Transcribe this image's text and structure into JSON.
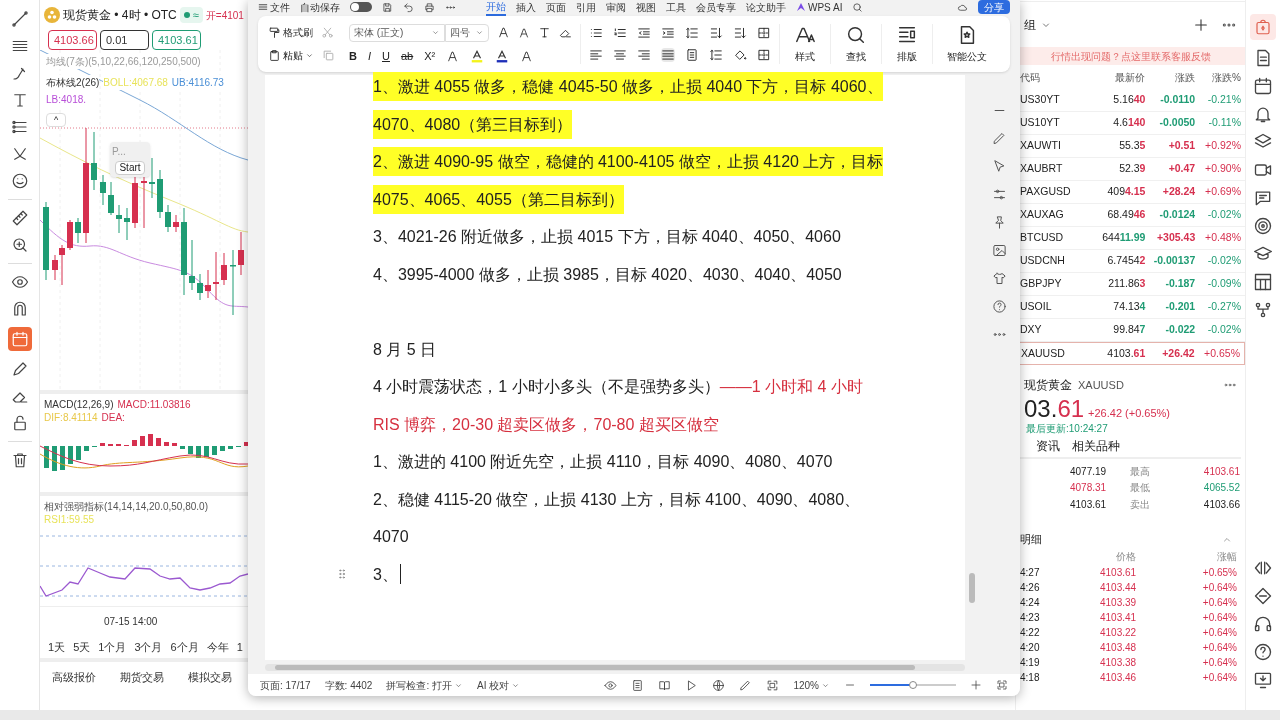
{
  "chart_app": {
    "title": "现货黄金 • 4时 • OTC",
    "status_badge": "≈",
    "open_label": "开=4101",
    "price_boxes": [
      {
        "text": "4103.66",
        "color": "#d6304f"
      },
      {
        "text": "0.01",
        "color": "#333333"
      },
      {
        "text": "4103.61",
        "color": "#1f9c74"
      }
    ],
    "ma_label": "均线(7条)(5,10,22,66,120,250,500)",
    "boll": [
      {
        "text": "布林线2(26)",
        "color": "#333333"
      },
      {
        "text": "BOLL:4067.68",
        "color": "#e8e35a"
      },
      {
        "text": "UB:4116.73",
        "color": "#4a8fd6"
      },
      {
        "text": "LB:4018.",
        "color": "#b84fd8"
      }
    ],
    "collapse": "^",
    "popup_title": "P...",
    "popup_button": "Start",
    "macd": [
      {
        "text": "MACD(12,26,9)",
        "color": "#333333"
      },
      {
        "text": "MACD:11.03816",
        "color": "#d6304f"
      },
      {
        "text": "DIF:8.41114",
        "color": "#e8c84a"
      },
      {
        "text": "DEA:",
        "color": "#d6304f"
      }
    ],
    "rsi": [
      {
        "text": "相对强弱指标(14,14,14,20.0,50,80.0)",
        "color": "#555555"
      },
      {
        "text": "RSI1:59.55",
        "color": "#e8e35a"
      }
    ],
    "time_label": "07-15 14:00",
    "ranges": [
      "1天",
      "5天",
      "1个月",
      "3个月",
      "6个月",
      "今年",
      "1"
    ],
    "bottom_tabs": [
      "高级报价",
      "期货交易",
      "模拟交易"
    ]
  },
  "word": {
    "file_menu": "文件",
    "autosave": "自动保存",
    "autosave_on": false,
    "tabs": [
      {
        "label": "开始",
        "selected": true
      },
      {
        "label": "插入",
        "selected": false
      },
      {
        "label": "页面",
        "selected": false
      },
      {
        "label": "引用",
        "selected": false
      },
      {
        "label": "审阅",
        "selected": false
      },
      {
        "label": "视图",
        "selected": false
      },
      {
        "label": "工具",
        "selected": false
      },
      {
        "label": "会员专享",
        "selected": false
      },
      {
        "label": "论文助手",
        "selected": false
      }
    ],
    "wps_ai": "WPS AI",
    "share": "分享",
    "format_painter": "格式刷",
    "paste": "粘贴",
    "font": "宋体 (正文)",
    "font_size": "四号",
    "format_buttons": [
      "B",
      "I",
      "U",
      "ab",
      "X²"
    ],
    "big_buttons": [
      "样式",
      "查找",
      "排版",
      "智能公文"
    ],
    "paragraphs": [
      {
        "kind": "text",
        "highlighted": true,
        "segments": [
          {
            "text": "1、激进 4055 做多，稳健 4045-50 做多，止损 4040 下方，目标 4060、4070、4080（第三目标到）"
          }
        ]
      },
      {
        "kind": "text",
        "highlighted": true,
        "segments": [
          {
            "text": "2、激进 4090-95 做空，稳健的 4100-4105 做空，止损 4120 上方，目标 4075、4065、4055（第二目标到）"
          }
        ]
      },
      {
        "kind": "text",
        "highlighted": false,
        "segments": [
          {
            "text": "3、4021-26 附近做多，止损 4015 下方，目标 4040、4050、4060"
          }
        ]
      },
      {
        "kind": "text",
        "highlighted": false,
        "segments": [
          {
            "text": "4、3995-4000 做多，止损 3985，目标 4020、4030、4040、4050"
          }
        ]
      },
      {
        "kind": "empty"
      },
      {
        "kind": "text",
        "highlighted": false,
        "segments": [
          {
            "text": "8 月 5 日"
          }
        ]
      },
      {
        "kind": "text",
        "highlighted": false,
        "segments": [
          {
            "text": "4 小时震荡状态，1 小时小多头（不是强势多头）"
          },
          {
            "text": "——1 小时和 4 小时 RIS 博弈，20-30 超卖区做多，70-80 超买区做空",
            "color": "#d6303f"
          }
        ]
      },
      {
        "kind": "text",
        "highlighted": false,
        "segments": [
          {
            "text": "1、激进的 4100 附近先空，止损 4110，目标 4090、4080、4070"
          }
        ]
      },
      {
        "kind": "text",
        "highlighted": false,
        "segments": [
          {
            "text": "2、稳健 4115-20 做空，止损 4130 上方，目标 4100、4090、4080、4070"
          }
        ]
      },
      {
        "kind": "cursor",
        "segments": [
          {
            "text": "3、"
          }
        ]
      }
    ],
    "status": {
      "page": "页面: 17/17",
      "words": "字数: 4402",
      "spell": "拼写检查: 打开",
      "proof": "AI 校对",
      "zoom": "120%",
      "zoom_slider": {
        "level": 0.5
      }
    }
  },
  "market": {
    "group": "组",
    "banner": "行情出现问题？点这里联系客服反馈",
    "columns": [
      "代码",
      "最新价",
      "涨跌",
      "涨跌%"
    ],
    "rows": [
      {
        "symbol": "US30YT",
        "price": {
          "main": "5.16",
          "tail": "40",
          "color": "#d6304f"
        },
        "change": "-0.0110",
        "change_pct": "-0.21%",
        "color": "#1f9c74",
        "selected": false
      },
      {
        "symbol": "US10YT",
        "price": {
          "main": "4.6",
          "tail": "140",
          "color": "#d6304f"
        },
        "change": "-0.0050",
        "change_pct": "-0.11%",
        "color": "#1f9c74",
        "selected": false
      },
      {
        "symbol": "XAUWTI",
        "price": {
          "main": "55.3",
          "tail": "5",
          "color": "#d6304f"
        },
        "change": "+0.51",
        "change_pct": "+0.92%",
        "color": "#d6304f",
        "selected": false
      },
      {
        "symbol": "XAUBRT",
        "price": {
          "main": "52.3",
          "tail": "9",
          "color": "#d6304f"
        },
        "change": "+0.47",
        "change_pct": "+0.90%",
        "color": "#d6304f",
        "selected": false
      },
      {
        "symbol": "PAXGUSD",
        "price": {
          "main": "409",
          "tail": "4.15",
          "color": "#d6304f"
        },
        "change": "+28.24",
        "change_pct": "+0.69%",
        "color": "#d6304f",
        "selected": false
      },
      {
        "symbol": "XAUXAG",
        "price": {
          "main": "68.49",
          "tail": "46",
          "color": "#d6304f"
        },
        "change": "-0.0124",
        "change_pct": "-0.02%",
        "color": "#1f9c74",
        "selected": false
      },
      {
        "symbol": "BTCUSD",
        "price": {
          "main": "644",
          "tail": "11.99",
          "color": "#1f9c74"
        },
        "change": "+305.43",
        "change_pct": "+0.48%",
        "color": "#d6304f",
        "selected": false
      },
      {
        "symbol": "USDCNH",
        "price": {
          "main": "6.7454",
          "tail": "2",
          "color": "#d6304f"
        },
        "change": "-0.00137",
        "change_pct": "-0.02%",
        "color": "#1f9c74",
        "selected": false
      },
      {
        "symbol": "GBPJPY",
        "price": {
          "main": "211.86",
          "tail": "3",
          "color": "#d6304f"
        },
        "change": "-0.187",
        "change_pct": "-0.09%",
        "color": "#1f9c74",
        "selected": false
      },
      {
        "symbol": "USOIL",
        "price": {
          "main": "74.13",
          "tail": "4",
          "color": "#1f9c74"
        },
        "change": "-0.201",
        "change_pct": "-0.27%",
        "color": "#1f9c74",
        "selected": false
      },
      {
        "symbol": "DXY",
        "price": {
          "main": "99.84",
          "tail": "7",
          "color": "#1f9c74"
        },
        "change": "-0.022",
        "change_pct": "-0.02%",
        "color": "#1f9c74",
        "selected": false
      },
      {
        "symbol": "XAUUSD",
        "price": {
          "main": "4103.",
          "tail": "61",
          "color": "#d6304f"
        },
        "change": "+26.42",
        "change_pct": "+0.65%",
        "color": "#d6304f",
        "selected": true
      }
    ],
    "detail": {
      "name": "现货黄金",
      "code": "XAUUSD",
      "price_main": "03.",
      "price_tail": "61",
      "change": "+26.42 (+0.65%)",
      "updated": "最后更新:10:24:27",
      "tabs": [
        "资讯",
        "相关品种"
      ],
      "stats": [
        {
          "left": {
            "text": "4077.19"
          },
          "label": "最高",
          "right": {
            "text": "4103.61",
            "color": "#d6304f"
          }
        },
        {
          "left": {
            "text": "4078.31",
            "color": "#d6304f"
          },
          "label": "最低",
          "right": {
            "text": "4065.52",
            "color": "#1f9c74"
          }
        },
        {
          "left": {
            "text": "4103.61"
          },
          "label": "卖出",
          "right": {
            "text": "4103.66"
          }
        }
      ]
    },
    "ticks_title": "明细",
    "ticks_columns": [
      "价格",
      "涨幅"
    ],
    "ticks": [
      {
        "time": "4:27",
        "price": "4103.61",
        "pct": "+0.65%"
      },
      {
        "time": "4:26",
        "price": "4103.44",
        "pct": "+0.64%"
      },
      {
        "time": "4:24",
        "price": "4103.39",
        "pct": "+0.64%"
      },
      {
        "time": "4:23",
        "price": "4103.41",
        "pct": "+0.64%"
      },
      {
        "time": "4:22",
        "price": "4103.22",
        "pct": "+0.64%"
      },
      {
        "time": "4:20",
        "price": "4103.48",
        "pct": "+0.64%"
      },
      {
        "time": "4:19",
        "price": "4103.38",
        "pct": "+0.64%"
      },
      {
        "time": "4:18",
        "price": "4103.46",
        "pct": "+0.64%"
      }
    ]
  }
}
